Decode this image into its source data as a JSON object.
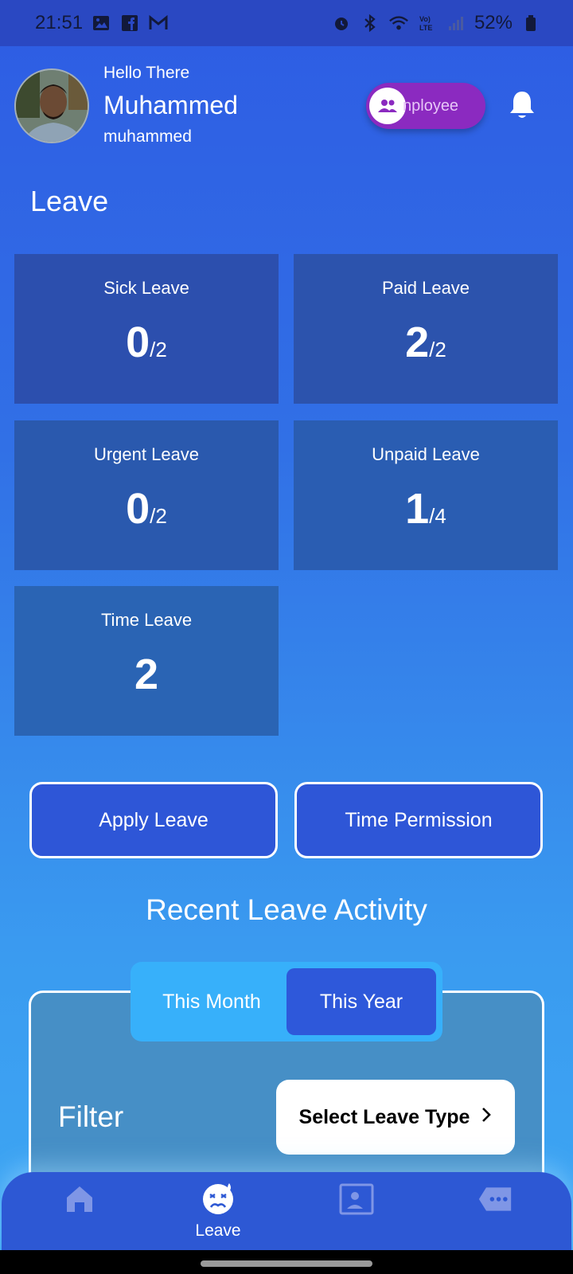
{
  "status_bar": {
    "time": "21:51",
    "battery": "52%"
  },
  "header": {
    "greeting": "Hello There",
    "name": "Muhammed",
    "username": "muhammed",
    "role_label": "nployee"
  },
  "leave_section": {
    "title": "Leave",
    "cards": [
      {
        "label": "Sick Leave",
        "used": "0",
        "total": "/2"
      },
      {
        "label": "Paid Leave",
        "used": "2",
        "total": "/2"
      },
      {
        "label": "Urgent Leave",
        "used": "0",
        "total": "/2"
      },
      {
        "label": "Unpaid Leave",
        "used": "1",
        "total": "/4"
      },
      {
        "label": "Time Leave",
        "used": "2",
        "total": ""
      }
    ],
    "colors": [
      "#2c4fae",
      "#2c53ad",
      "#2a59ae",
      "#2a5db2",
      "#2a64b4"
    ]
  },
  "actions": {
    "apply_leave": "Apply Leave",
    "time_permission": "Time Permission"
  },
  "recent": {
    "title": "Recent Leave Activity",
    "tabs": [
      "This Month",
      "This Year"
    ],
    "active_tab": "This Year",
    "filter_label": "Filter",
    "filter_button": "Select Leave Type"
  },
  "bottom_nav": {
    "items": [
      {
        "icon": "home-icon",
        "label": ""
      },
      {
        "icon": "leave-icon",
        "label": "Leave"
      },
      {
        "icon": "profile-card-icon",
        "label": ""
      },
      {
        "icon": "more-icon",
        "label": ""
      }
    ],
    "active": "Leave"
  }
}
